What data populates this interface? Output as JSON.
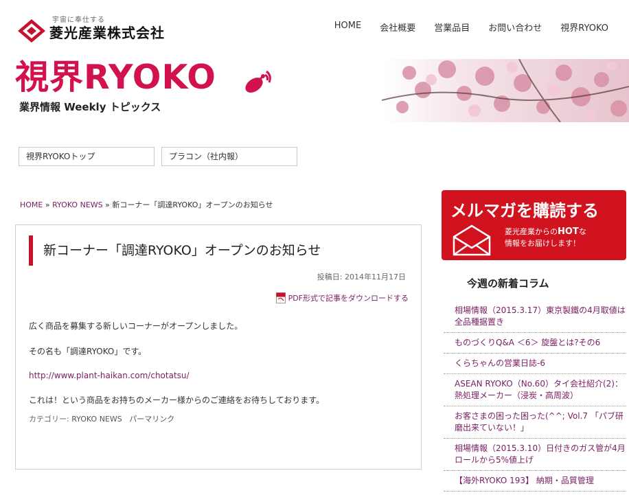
{
  "header": {
    "logo_tagline": "宇宙に奉仕する",
    "company_name": "菱光産業株式会社",
    "nav": [
      "HOME",
      "会社概要",
      "営業品目",
      "お問い合わせ",
      "視界RYOKO"
    ]
  },
  "banner": {
    "title": "視界RYOKO",
    "subtitle": "業界情報 Weekly トピックス"
  },
  "sub_nav": [
    "視界RYOKOトップ",
    "プラコン（社内報）"
  ],
  "breadcrumb": {
    "home": "HOME",
    "separator": "»",
    "category": "RYOKO NEWS",
    "current": "新コーナー「調達RYOKO」オープンのお知らせ"
  },
  "article": {
    "title": "新コーナー「調達RYOKO」オープンのお知らせ",
    "date": "投稿日: 2014年11月17日",
    "pdf_link": "PDF形式で記事をダウンロードする",
    "body": [
      "広く商品を募集する新しいコーナーがオープンしました。",
      "その名も「調達RYOKO」です。"
    ],
    "url": "http://www.plant-haikan.com/chotatsu/",
    "closing": "これは！という商品をお持ちのメーカー様からのご連絡をお待ちしております。",
    "meta_category_label": "カテゴリー:",
    "meta_category": "RYOKO NEWS",
    "meta_permalink": "パーマリンク"
  },
  "sidebar": {
    "newsletter": {
      "heading": "メルマガを購読する",
      "text_line1_prefix": "菱光産業からの",
      "text_hot": "HOT",
      "text_line1_suffix": "な",
      "text_line2": "情報をお届けします！"
    },
    "column_heading": "今週の新着コラム",
    "columns": [
      "相場情報（2015.3.17）東京製鐵の4月取値は全品種据置き",
      "ものづくりQ&A ＜6＞ 旋盤とは?その6",
      "くらちゃんの営業日誌-6",
      "ASEAN RYOKO（No.60）タイ会社紹介(2)：熱処理メーカー（浸炭・高周波）",
      "お客さまの困った困った(^^; Vol.7 「パブ研磨出来ていない！」",
      "相場情報（2015.3.10）日付きのガス管が4月ロールから5%値上げ",
      "【海外RYOKO 193】 納期・品質管理"
    ]
  },
  "colors": {
    "brand_red": "#d2124c",
    "link_purple": "#7a1d63",
    "newsletter_red": "#d1121f"
  }
}
